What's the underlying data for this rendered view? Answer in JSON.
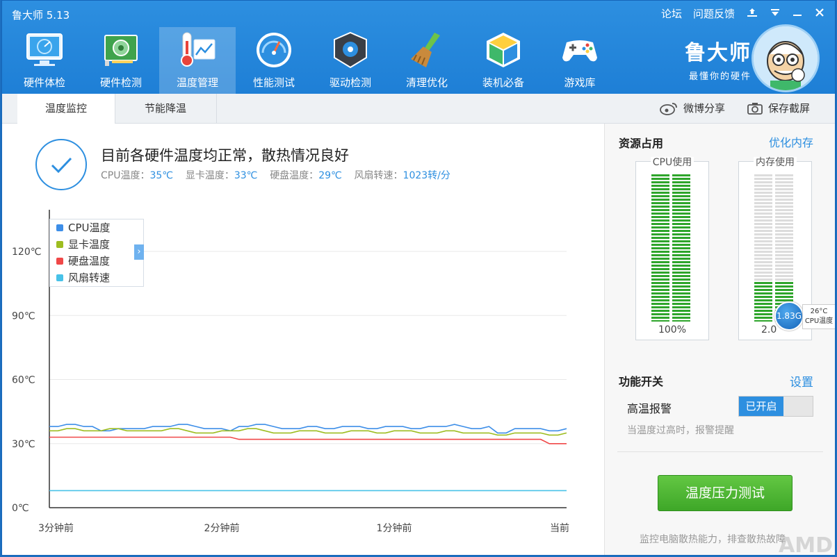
{
  "window": {
    "title": "鲁大师 5.13",
    "links": [
      "论坛",
      "问题反馈"
    ],
    "buttons": [
      "skin-icon",
      "menu-icon",
      "minimize-icon",
      "close-icon"
    ]
  },
  "nav": {
    "items": [
      {
        "label": "硬件体检",
        "icon": "monitor-icon"
      },
      {
        "label": "硬件检测",
        "icon": "hardware-board-icon"
      },
      {
        "label": "温度管理",
        "icon": "thermometer-icon",
        "active": true
      },
      {
        "label": "性能测试",
        "icon": "speedometer-icon"
      },
      {
        "label": "驱动检测",
        "icon": "gear-drive-icon"
      },
      {
        "label": "清理优化",
        "icon": "broom-icon"
      },
      {
        "label": "装机必备",
        "icon": "box-icon"
      },
      {
        "label": "游戏库",
        "icon": "gamepad-icon"
      }
    ]
  },
  "brand": {
    "name": "鲁大师",
    "slogan": "最懂你的硬件"
  },
  "tabs": [
    {
      "label": "温度监控",
      "active": true
    },
    {
      "label": "节能降温"
    }
  ],
  "toolbar": {
    "share": "微博分享",
    "screenshot": "保存截屏"
  },
  "status": {
    "message": "目前各硬件温度均正常，散热情况良好",
    "readings": [
      {
        "label": "CPU温度：",
        "value": "35℃"
      },
      {
        "label": "显卡温度：",
        "value": "33℃"
      },
      {
        "label": "硬盘温度：",
        "value": "29℃"
      },
      {
        "label": "风扇转速：",
        "value": "1023转/分"
      }
    ]
  },
  "chart_data": {
    "type": "line",
    "y_tick_labels": [
      "0℃",
      "30℃",
      "60℃",
      "90℃",
      "120℃"
    ],
    "ylim": [
      0,
      120
    ],
    "x_tick_labels": [
      "3分钟前",
      "2分钟前",
      "1分钟前",
      "当前"
    ],
    "legend_position": "top-left",
    "grid": true,
    "series": [
      {
        "name": "CPU温度",
        "color": "#3d8ee8",
        "values": [
          38,
          38,
          39,
          39,
          38,
          38,
          36,
          36,
          37,
          37,
          37,
          37,
          38,
          38,
          38,
          39,
          39,
          38,
          37,
          37,
          37,
          36,
          38,
          38,
          39,
          39,
          38,
          37,
          37,
          37,
          38,
          38,
          37,
          37,
          38,
          38,
          38,
          37,
          37,
          38,
          38,
          38,
          37,
          37,
          38,
          38,
          38,
          39,
          38,
          37,
          37,
          38,
          35,
          35,
          37,
          37,
          37,
          37,
          36,
          36,
          37
        ]
      },
      {
        "name": "显卡温度",
        "color": "#9dbd20",
        "values": [
          36,
          36,
          37,
          37,
          36,
          36,
          36,
          37,
          37,
          36,
          36,
          36,
          36,
          36,
          37,
          37,
          36,
          35,
          35,
          35,
          36,
          36,
          36,
          37,
          37,
          36,
          35,
          35,
          35,
          36,
          36,
          36,
          35,
          35,
          35,
          36,
          36,
          36,
          35,
          35,
          36,
          36,
          36,
          35,
          35,
          35,
          36,
          36,
          35,
          35,
          35,
          35,
          34,
          34,
          35,
          35,
          35,
          35,
          34,
          34,
          35
        ]
      },
      {
        "name": "硬盘温度",
        "color": "#f04848",
        "values": [
          33,
          33,
          33,
          33,
          33,
          33,
          33,
          33,
          33,
          33,
          33,
          33,
          33,
          33,
          33,
          33,
          33,
          33,
          33,
          33,
          33,
          33,
          32,
          32,
          32,
          32,
          32,
          32,
          32,
          32,
          32,
          32,
          32,
          32,
          32,
          32,
          32,
          32,
          32,
          32,
          32,
          32,
          32,
          32,
          32,
          32,
          32,
          32,
          32,
          32,
          32,
          32,
          32,
          32,
          32,
          32,
          32,
          32,
          30,
          30,
          30
        ]
      },
      {
        "name": "风扇转速",
        "color": "#48c2e8",
        "values": [
          8,
          8,
          8,
          8,
          8,
          8,
          8,
          8,
          8,
          8,
          8,
          8,
          8,
          8,
          8,
          8,
          8,
          8,
          8,
          8,
          8,
          8,
          8,
          8,
          8,
          8,
          8,
          8,
          8,
          8,
          8,
          8,
          8,
          8,
          8,
          8,
          8,
          8,
          8,
          8,
          8,
          8,
          8,
          8,
          8,
          8,
          8,
          8,
          8,
          8,
          8,
          8,
          8,
          8,
          8,
          8,
          8,
          8,
          8,
          8,
          8
        ]
      }
    ]
  },
  "resources": {
    "title": "资源占用",
    "optimize_link": "优化内存",
    "cpu": {
      "label": "CPU使用",
      "value": "100%",
      "fraction": 1.0
    },
    "memory": {
      "label": "内存使用",
      "value": "2.0",
      "fraction": 0.27
    },
    "bubble": {
      "value": "1.83G",
      "tip_temp": "26°C",
      "tip_label": "CPU温度"
    }
  },
  "functions": {
    "title": "功能开关",
    "settings_link": "设置",
    "alarm_label": "高温报警",
    "toggle_state": "已开启",
    "alarm_note": "当温度过高时，报警提醒"
  },
  "stress": {
    "button": "温度压力测试",
    "note": "监控电脑散热能力，排查散热故障"
  },
  "watermark": "AMD"
}
